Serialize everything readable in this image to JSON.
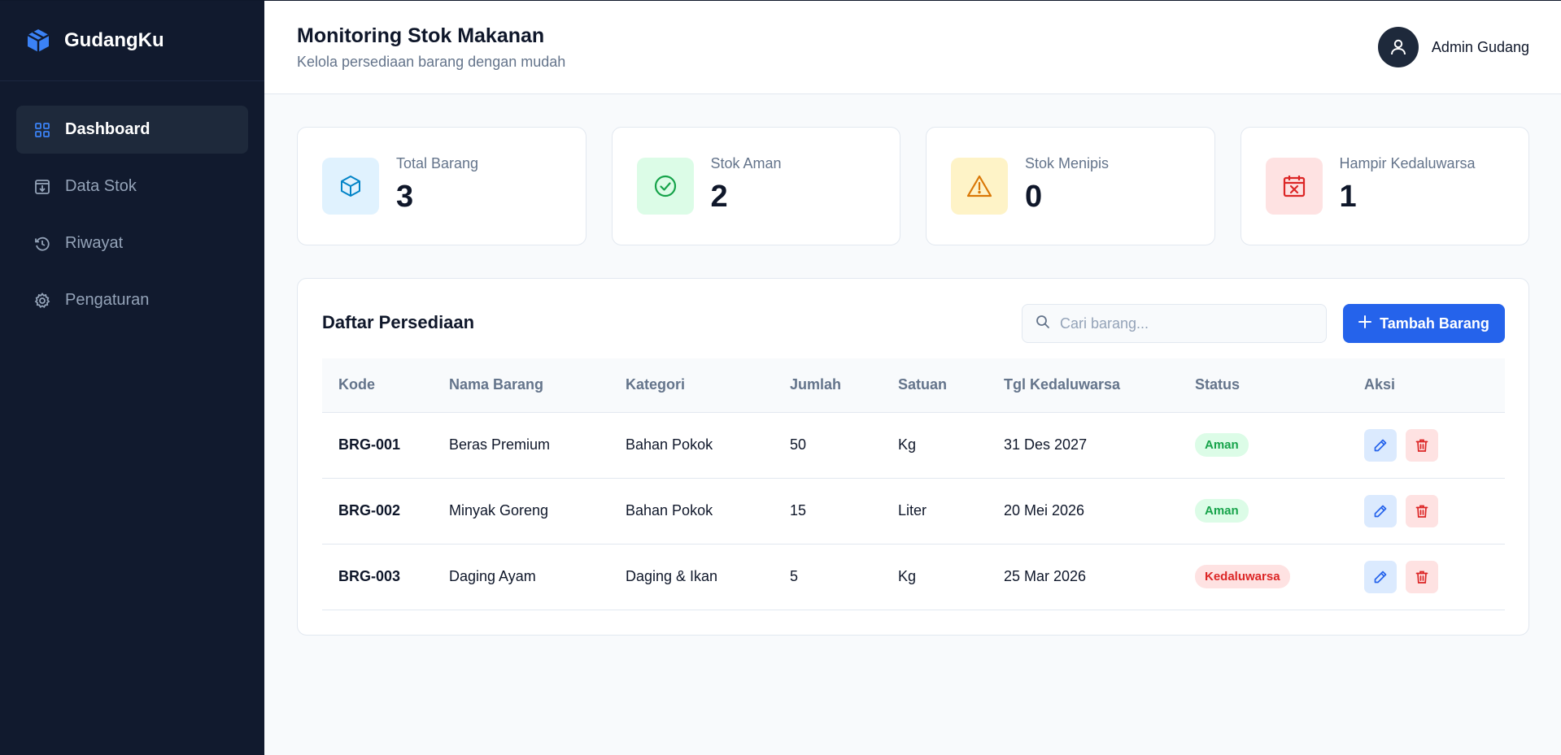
{
  "app": {
    "name": "GudangKu"
  },
  "sidebar": {
    "items": [
      {
        "label": "Dashboard",
        "icon": "dashboard-grid-icon",
        "active": true
      },
      {
        "label": "Data Stok",
        "icon": "box-download-icon",
        "active": false
      },
      {
        "label": "Riwayat",
        "icon": "history-icon",
        "active": false
      },
      {
        "label": "Pengaturan",
        "icon": "gear-icon",
        "active": false
      }
    ]
  },
  "header": {
    "title": "Monitoring Stok Makanan",
    "subtitle": "Kelola persediaan barang dengan mudah",
    "user_name": "Admin Gudang"
  },
  "stats": [
    {
      "label": "Total Barang",
      "value": "3",
      "icon": "cube-icon",
      "color": "#0284c7",
      "bg": "#e0f2fe"
    },
    {
      "label": "Stok Aman",
      "value": "2",
      "icon": "check-circle-icon",
      "color": "#16a34a",
      "bg": "#dcfce7"
    },
    {
      "label": "Stok Menipis",
      "value": "0",
      "icon": "warning-triangle-icon",
      "color": "#d97706",
      "bg": "#fef3c7"
    },
    {
      "label": "Hampir Kedaluwarsa",
      "value": "1",
      "icon": "calendar-x-icon",
      "color": "#dc2626",
      "bg": "#fee2e2"
    }
  ],
  "inventory": {
    "title": "Daftar Persediaan",
    "search_placeholder": "Cari barang...",
    "add_label": "Tambah Barang",
    "columns": [
      "Kode",
      "Nama Barang",
      "Kategori",
      "Jumlah",
      "Satuan",
      "Tgl Kedaluwarsa",
      "Status",
      "Aksi"
    ],
    "rows": [
      {
        "code": "BRG-001",
        "name": "Beras Premium",
        "category": "Bahan Pokok",
        "qty": "50",
        "unit": "Kg",
        "expiry": "31 Des 2027",
        "status": "Aman",
        "status_type": "aman"
      },
      {
        "code": "BRG-002",
        "name": "Minyak Goreng",
        "category": "Bahan Pokok",
        "qty": "15",
        "unit": "Liter",
        "expiry": "20 Mei 2026",
        "status": "Aman",
        "status_type": "aman"
      },
      {
        "code": "BRG-003",
        "name": "Daging Ayam",
        "category": "Daging & Ikan",
        "qty": "5",
        "unit": "Kg",
        "expiry": "25 Mar 2026",
        "status": "Kedaluwarsa",
        "status_type": "exp"
      }
    ]
  },
  "colors": {
    "sidebar_bg": "#111a2e",
    "accent": "#2563eb",
    "safe": "#16a34a",
    "danger": "#dc2626"
  }
}
